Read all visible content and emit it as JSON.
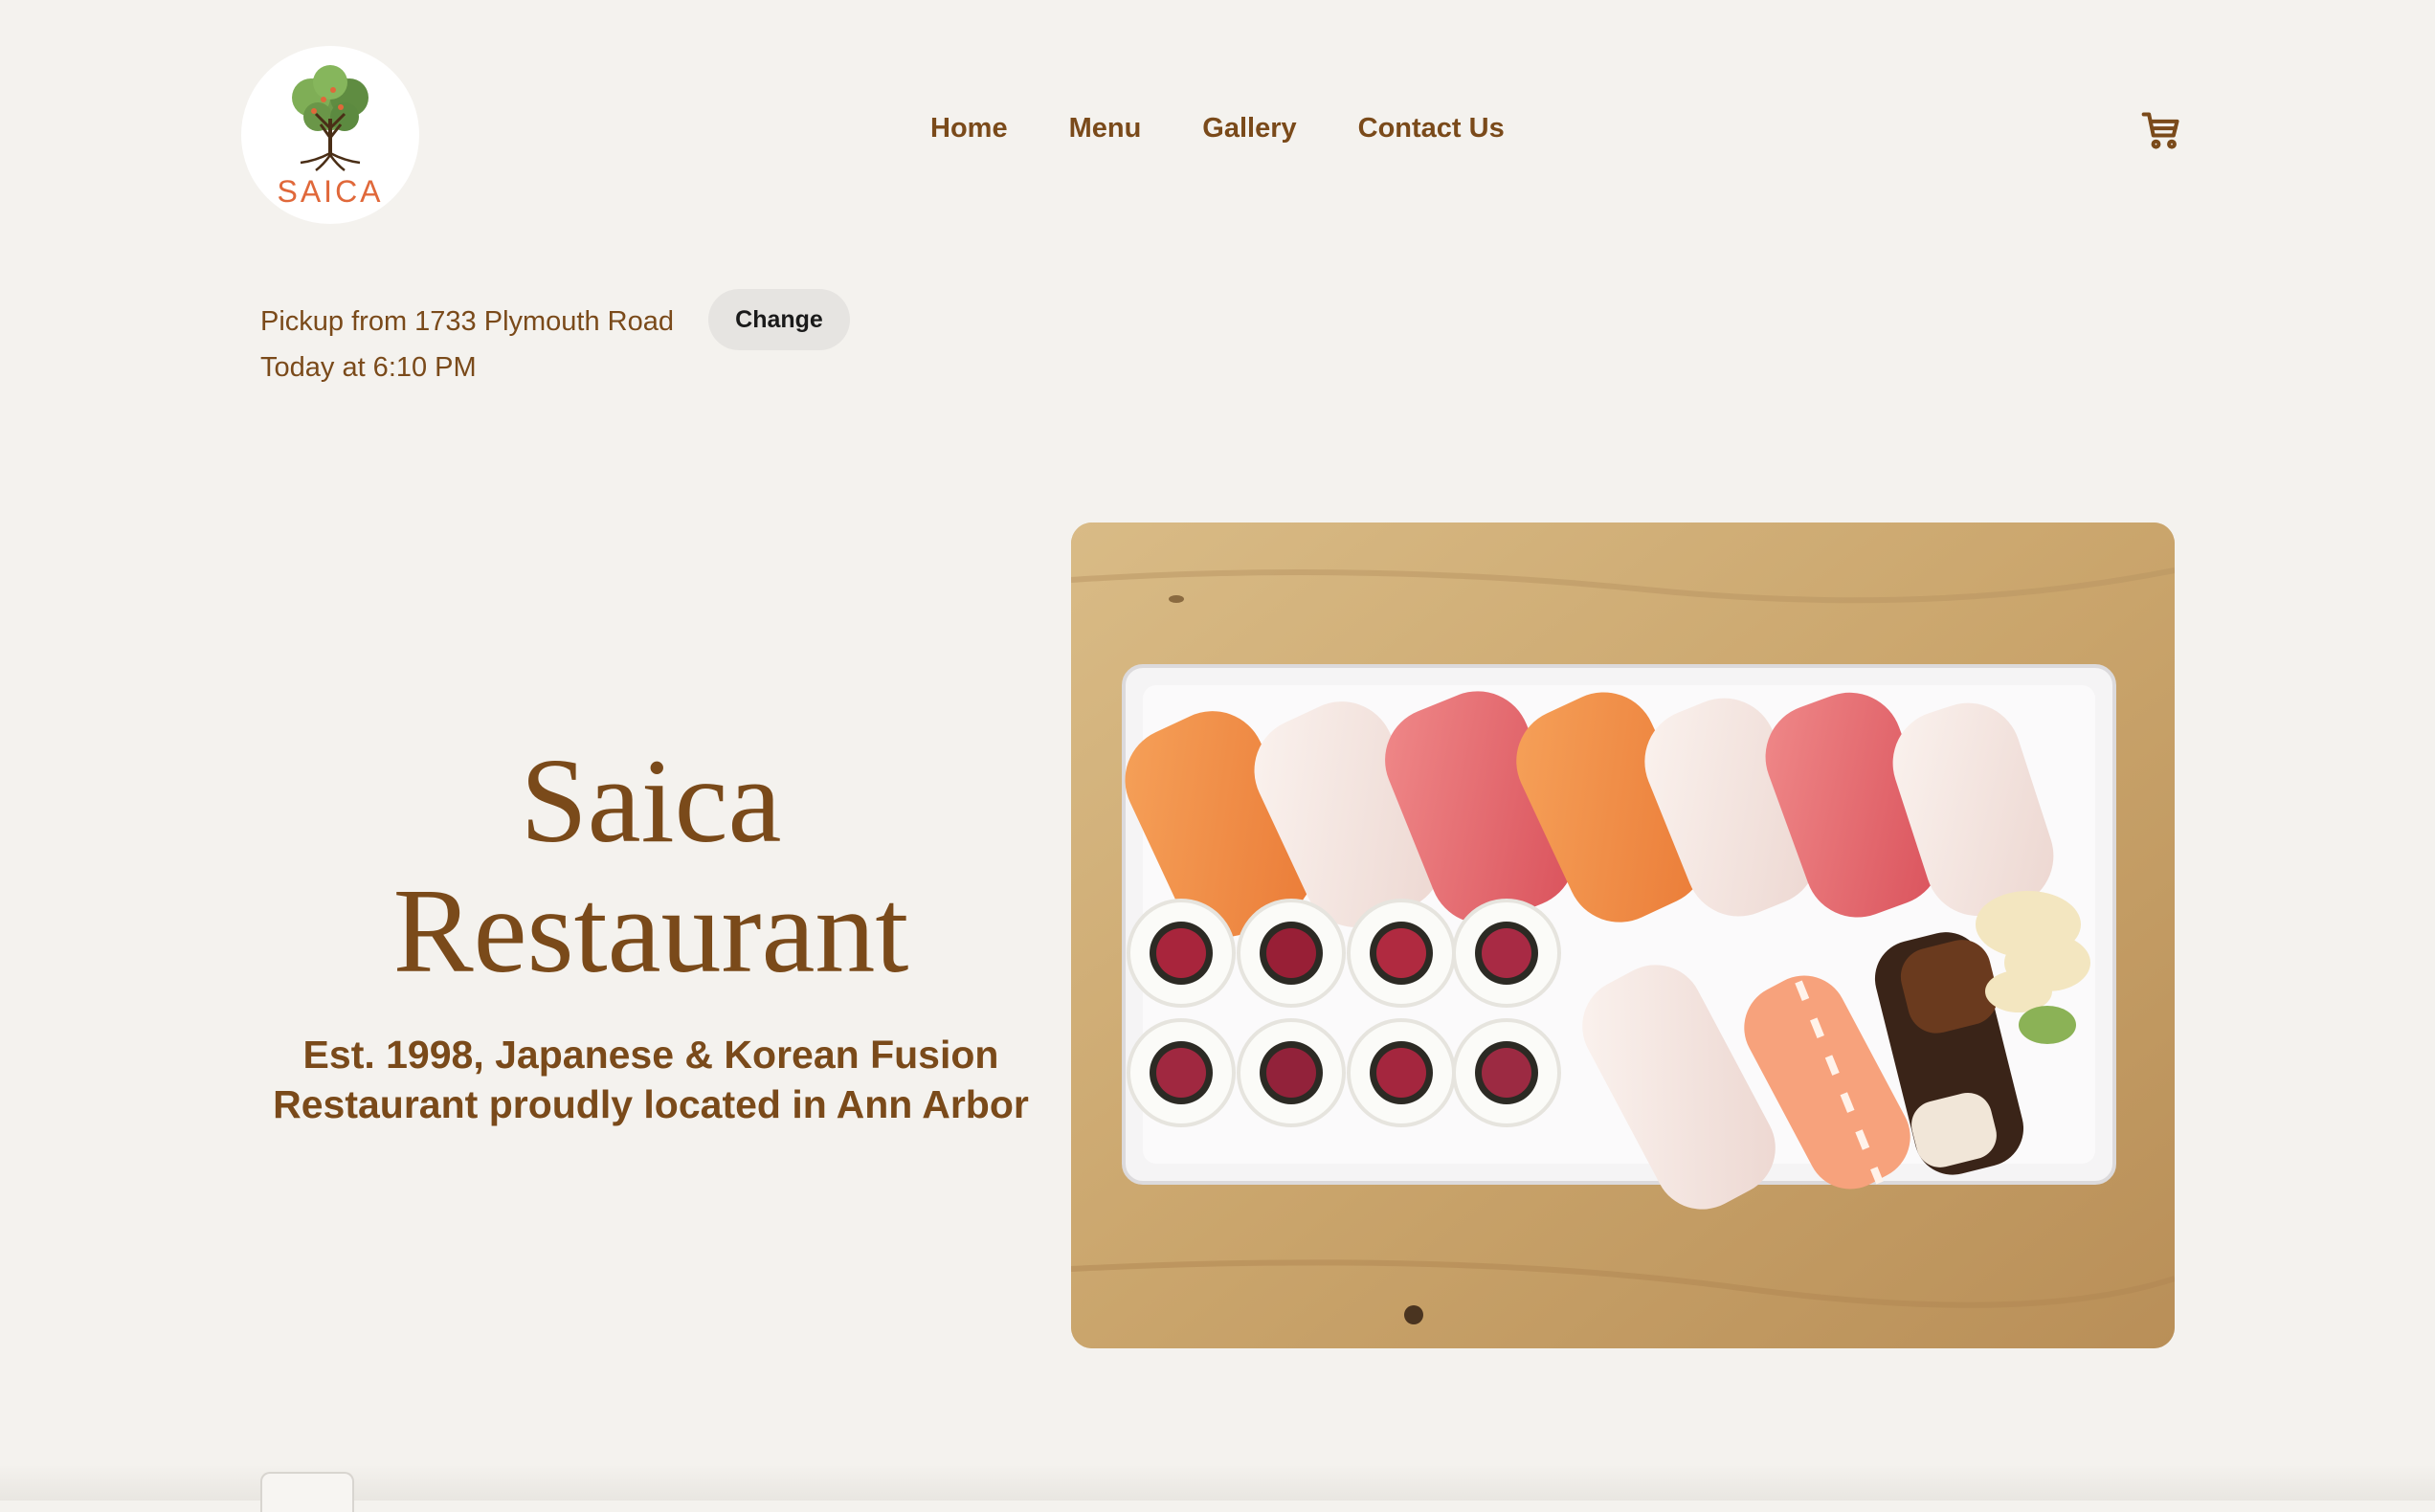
{
  "brand": {
    "logo_text": "SAICA"
  },
  "nav": {
    "items": [
      {
        "label": "Home"
      },
      {
        "label": "Menu"
      },
      {
        "label": "Gallery"
      },
      {
        "label": "Contact Us"
      }
    ],
    "cart_icon": "cart-icon"
  },
  "pickup": {
    "location_text": "Pickup from 1733 Plymouth Road",
    "time_text": "Today at 6:10 PM",
    "change_label": "Change"
  },
  "hero": {
    "title_line1": "Saica",
    "title_line2": "Restaurant",
    "subtitle_line1": "Est. 1998, Japanese & Korean Fusion",
    "subtitle_line2": "Restaurant proudly located in Ann Arbor",
    "image_alt": "sushi platter photo"
  },
  "colors": {
    "background": "#f4f2ee",
    "brand_brown": "#7a4a1a",
    "logo_orange": "#e0683a",
    "button_bg": "#e6e4e1"
  }
}
